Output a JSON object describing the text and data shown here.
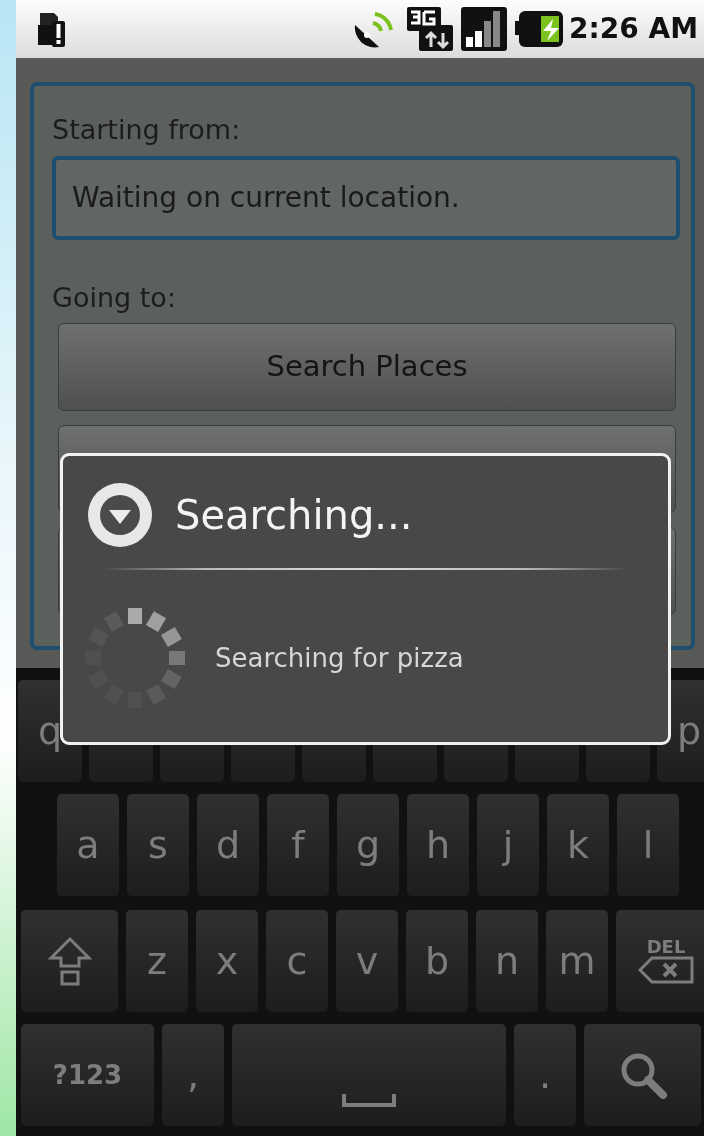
{
  "status_bar": {
    "time": "2:26 AM"
  },
  "form": {
    "start_label": "Starting from:",
    "start_field": {
      "value": "Waiting on current location."
    },
    "destination_label": "Going to:",
    "buttons": [
      {
        "kind": "labeled",
        "label": "Search Places"
      },
      {
        "kind": "covered"
      },
      {
        "kind": "covered"
      }
    ]
  },
  "dialog": {
    "title": "Searching...",
    "message": "Searching for pizza"
  },
  "keyboard": {
    "rows": [
      [
        {
          "kind": "letter",
          "label": "q"
        },
        {
          "kind": "covered"
        },
        {
          "kind": "covered"
        },
        {
          "kind": "covered"
        },
        {
          "kind": "covered"
        },
        {
          "kind": "covered"
        },
        {
          "kind": "covered"
        },
        {
          "kind": "covered"
        },
        {
          "kind": "covered"
        },
        {
          "kind": "letter",
          "label": "p"
        }
      ],
      [
        {
          "kind": "letter",
          "label": "a"
        },
        {
          "kind": "letter",
          "label": "s"
        },
        {
          "kind": "letter",
          "label": "d"
        },
        {
          "kind": "letter",
          "label": "f"
        },
        {
          "kind": "letter",
          "label": "g"
        },
        {
          "kind": "letter",
          "label": "h"
        },
        {
          "kind": "letter",
          "label": "j"
        },
        {
          "kind": "letter",
          "label": "k"
        },
        {
          "kind": "letter",
          "label": "l"
        }
      ],
      [
        {
          "kind": "shift"
        },
        {
          "kind": "letter",
          "label": "z"
        },
        {
          "kind": "letter",
          "label": "x"
        },
        {
          "kind": "letter",
          "label": "c"
        },
        {
          "kind": "letter",
          "label": "v"
        },
        {
          "kind": "letter",
          "label": "b"
        },
        {
          "kind": "letter",
          "label": "n"
        },
        {
          "kind": "letter",
          "label": "m"
        },
        {
          "kind": "delete",
          "label": "DEL"
        }
      ],
      [
        {
          "kind": "symbols",
          "label": "?123"
        },
        {
          "kind": "letter",
          "label": ","
        },
        {
          "kind": "space"
        },
        {
          "kind": "letter",
          "label": "."
        },
        {
          "kind": "search"
        }
      ]
    ]
  }
}
